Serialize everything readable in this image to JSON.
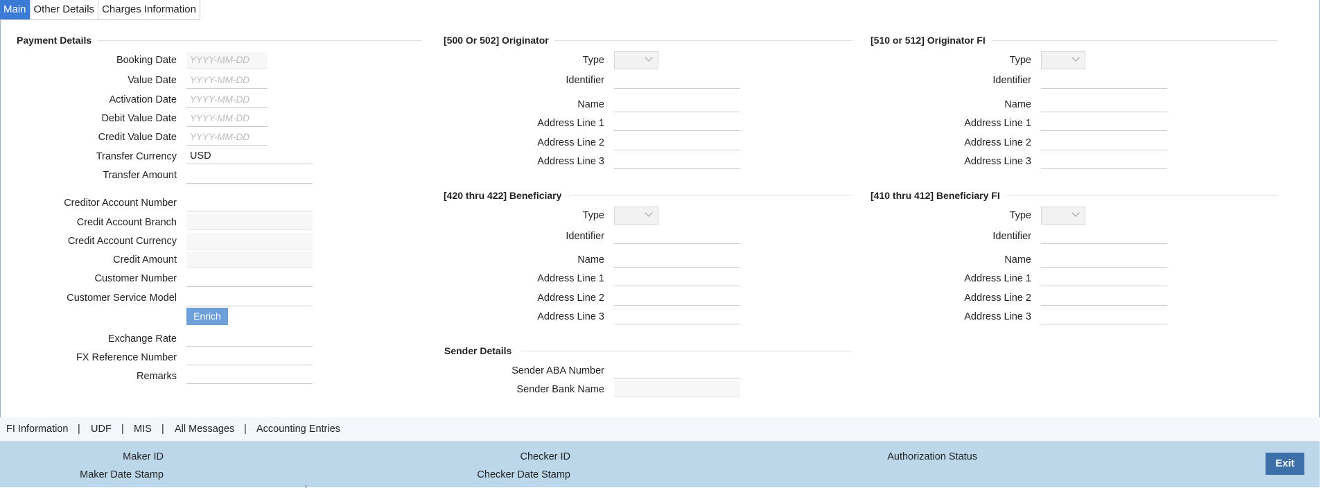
{
  "tabs": [
    "Main",
    "Other Details",
    "Charges Information"
  ],
  "payment_details": {
    "title": "Payment Details",
    "booking_date": {
      "label": "Booking Date",
      "placeholder": "YYYY-MM-DD"
    },
    "value_date": {
      "label": "Value Date",
      "placeholder": "YYYY-MM-DD"
    },
    "activation_date": {
      "label": "Activation Date",
      "placeholder": "YYYY-MM-DD"
    },
    "debit_value_date": {
      "label": "Debit Value Date",
      "placeholder": "YYYY-MM-DD"
    },
    "credit_value_date": {
      "label": "Credit Value Date",
      "placeholder": "YYYY-MM-DD"
    },
    "transfer_currency": {
      "label": "Transfer Currency",
      "value": "USD"
    },
    "transfer_amount": {
      "label": "Transfer Amount",
      "value": ""
    },
    "creditor_account_number": {
      "label": "Creditor Account Number",
      "value": ""
    },
    "credit_account_branch": {
      "label": "Credit Account Branch",
      "value": ""
    },
    "credit_account_currency": {
      "label": "Credit Account Currency",
      "value": ""
    },
    "credit_amount": {
      "label": "Credit Amount",
      "value": ""
    },
    "customer_number": {
      "label": "Customer Number",
      "value": ""
    },
    "customer_service_model": {
      "label": "Customer Service Model",
      "value": ""
    },
    "enrich_button": "Enrich",
    "exchange_rate": {
      "label": "Exchange Rate",
      "value": ""
    },
    "fx_reference_number": {
      "label": "FX Reference Number",
      "value": ""
    },
    "remarks": {
      "label": "Remarks",
      "value": ""
    }
  },
  "originator": {
    "title": "[500 Or 502] Originator",
    "type_label": "Type",
    "identifier_label": "Identifier",
    "name_label": "Name",
    "address1_label": "Address Line 1",
    "address2_label": "Address Line 2",
    "address3_label": "Address Line 3"
  },
  "originator_fi": {
    "title": "[510 or 512] Originator FI",
    "type_label": "Type",
    "identifier_label": "Identifier",
    "name_label": "Name",
    "address1_label": "Address Line 1",
    "address2_label": "Address Line 2",
    "address3_label": "Address Line 3"
  },
  "beneficiary": {
    "title": "[420 thru 422] Beneficiary",
    "type_label": "Type",
    "identifier_label": "Identifier",
    "name_label": "Name",
    "address1_label": "Address Line 1",
    "address2_label": "Address Line 2",
    "address3_label": "Address Line 3"
  },
  "beneficiary_fi": {
    "title": "[410 thru 412] Beneficiary FI",
    "type_label": "Type",
    "identifier_label": "Identifier",
    "name_label": "Name",
    "address1_label": "Address Line 1",
    "address2_label": "Address Line 2",
    "address3_label": "Address Line 3"
  },
  "sender_details": {
    "title": "Sender Details",
    "aba_label": "Sender ABA Number",
    "bank_name_label": "Sender Bank Name"
  },
  "sublinks": [
    "FI Information",
    "|",
    "UDF",
    "|",
    "MIS",
    "|",
    "All Messages",
    "|",
    "Accounting Entries"
  ],
  "footer": {
    "maker_id": "Maker ID",
    "maker_date_stamp": "Maker Date Stamp",
    "checker_id": "Checker ID",
    "checker_date_stamp": "Checker Date Stamp",
    "authorization_status": "Authorization Status",
    "exit": "Exit"
  },
  "colors": {
    "accent": "#3a7bd5",
    "footer_bg": "#bcd6ea",
    "exit_bg": "#3d6fa8"
  }
}
